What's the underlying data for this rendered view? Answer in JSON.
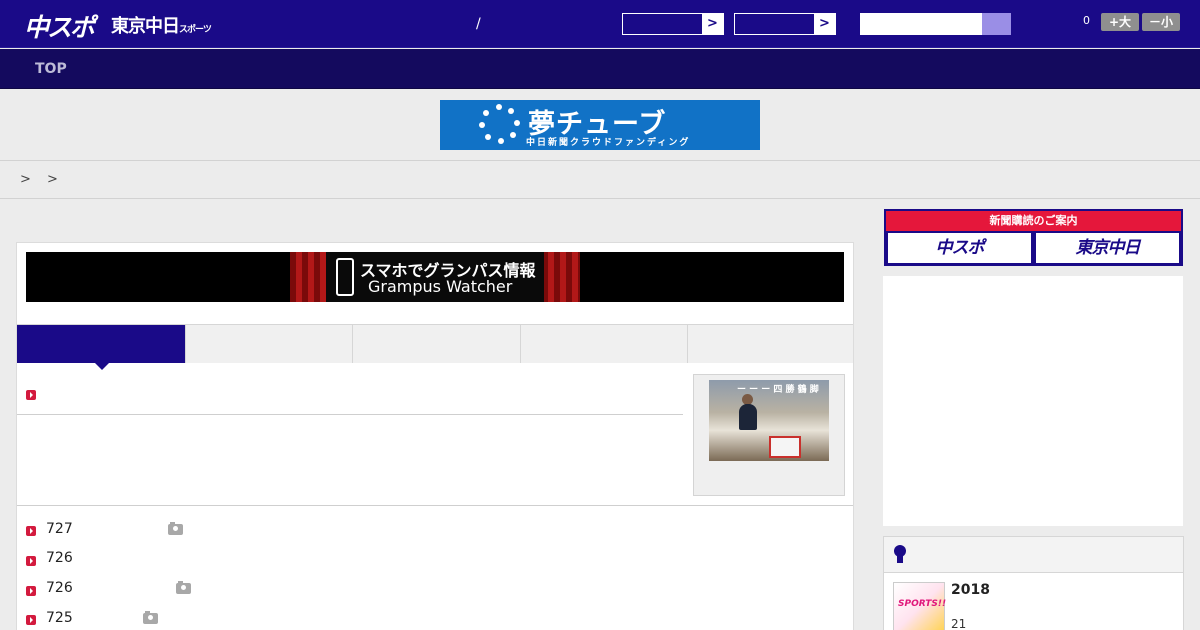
{
  "header": {
    "logo_primary": "中スポ",
    "logo_secondary": "東京中日",
    "logo_secondary_small": "スポーツ",
    "separator": "/",
    "select1_arrow": ">",
    "select2_arrow": ">",
    "search_placeholder": "",
    "counter": "0",
    "font_large": "+大",
    "font_small": "－小"
  },
  "nav": {
    "top_label": "TOP"
  },
  "banner": {
    "title": "夢チューブ",
    "subtitle": "中日新聞クラウドファンディング"
  },
  "breadcrumb": {
    "text": "> >"
  },
  "main": {
    "grampus_title": "スマホでグランパス情報",
    "grampus_subtitle": "Grampus Watcher",
    "thumb_caption": "ー ー ー 四 勝 鶴 脚",
    "tabs": [
      "",
      "",
      "",
      "",
      ""
    ],
    "list": [
      {
        "num": "727",
        "photo": true
      },
      {
        "num": "726",
        "photo": false
      },
      {
        "num": "726",
        "photo": true
      },
      {
        "num": "725",
        "photo": true
      }
    ]
  },
  "sidebar": {
    "subscribe_header": "新聞購読のご案内",
    "subscribe_left": "中スポ",
    "subscribe_right": "東京中日",
    "ranking_item_year": "2018",
    "ranking_item_num": "21",
    "ranking_thumb_text": "SPORTS!!"
  },
  "colors": {
    "brand": "#1a0a88",
    "nav": "#140a5e",
    "accent_red": "#e5173b",
    "banner_blue": "#1172c6"
  }
}
